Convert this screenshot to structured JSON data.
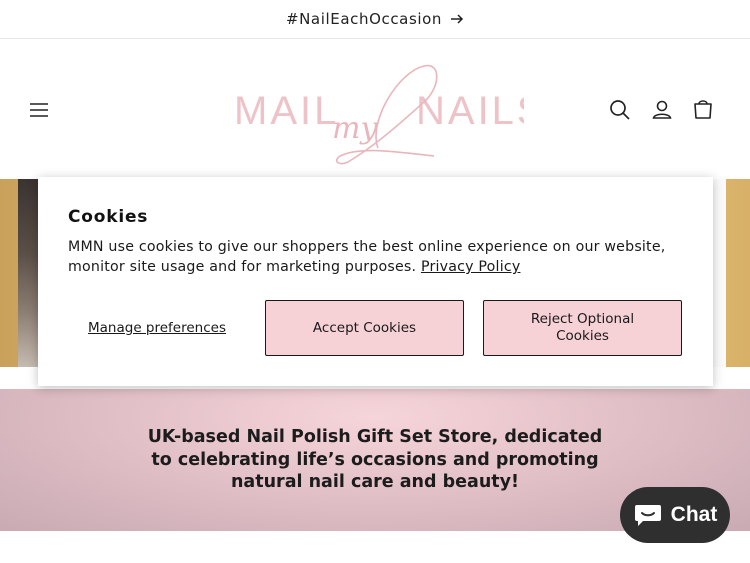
{
  "announcement": {
    "text": "#NailEachOccasion",
    "icon": "arrow-right-icon"
  },
  "header": {
    "logo_text": {
      "left": "MAIL",
      "script": "my",
      "right": "NAILS"
    },
    "icons": [
      "menu-icon",
      "search-icon",
      "account-icon",
      "cart-icon"
    ]
  },
  "cookie_banner": {
    "title": "Cookies",
    "message": "MMN use cookies to give our shoppers the best online experience on our website, monitor site usage and for marketing purposes.",
    "policy_link": "Privacy Policy",
    "manage_label": "Manage preferences",
    "accept_label": "Accept Cookies",
    "reject_label": "Reject Optional Cookies"
  },
  "banner": {
    "text": "UK-based Nail Polish Gift Set Store, dedicated to celebrating life’s occasions and promoting natural nail care and beauty!"
  },
  "chat": {
    "label": "Chat",
    "icon": "chat-bubble-icon"
  },
  "colors": {
    "brand_pink": "#e9b9bf",
    "button_pink": "#f6d1d6",
    "chat_bg": "#2f2f2f"
  }
}
